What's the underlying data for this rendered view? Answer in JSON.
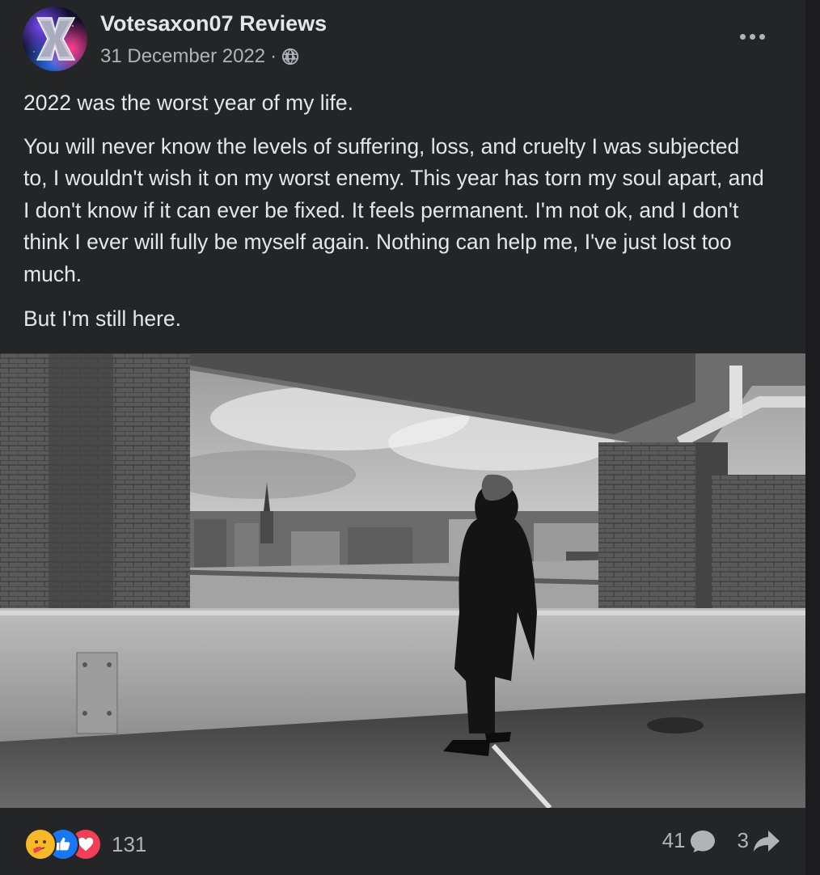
{
  "post": {
    "author": "Votesaxon07 Reviews",
    "date": "31 December 2022",
    "separator": "·",
    "privacy_icon": "globe-icon",
    "menu_icon": "more-options-icon",
    "paragraphs": [
      "2022 was the worst year of my life.",
      "You will never know the levels of suffering, loss, and cruelty I was subjected to, I wouldn't wish it on my worst enemy. This year has torn my soul apart, and I don't know if it can ever be fixed. It feels permanent. I'm not ok, and I don't think I ever will fully be myself again. Nothing can help me, I've just lost too much.",
      "But I'm still here."
    ]
  },
  "engagement": {
    "reactions": [
      "care-reaction-icon",
      "like-reaction-icon",
      "love-reaction-icon"
    ],
    "reaction_count": "131",
    "comment_count": "41",
    "share_count": "3"
  },
  "colors": {
    "card_bg": "#242526",
    "text_primary": "#e4e6eb",
    "text_secondary": "#b0b3b8",
    "like_blue": "#1877f2",
    "love_red": "#f33e58",
    "care_yellow": "#f7b928"
  }
}
